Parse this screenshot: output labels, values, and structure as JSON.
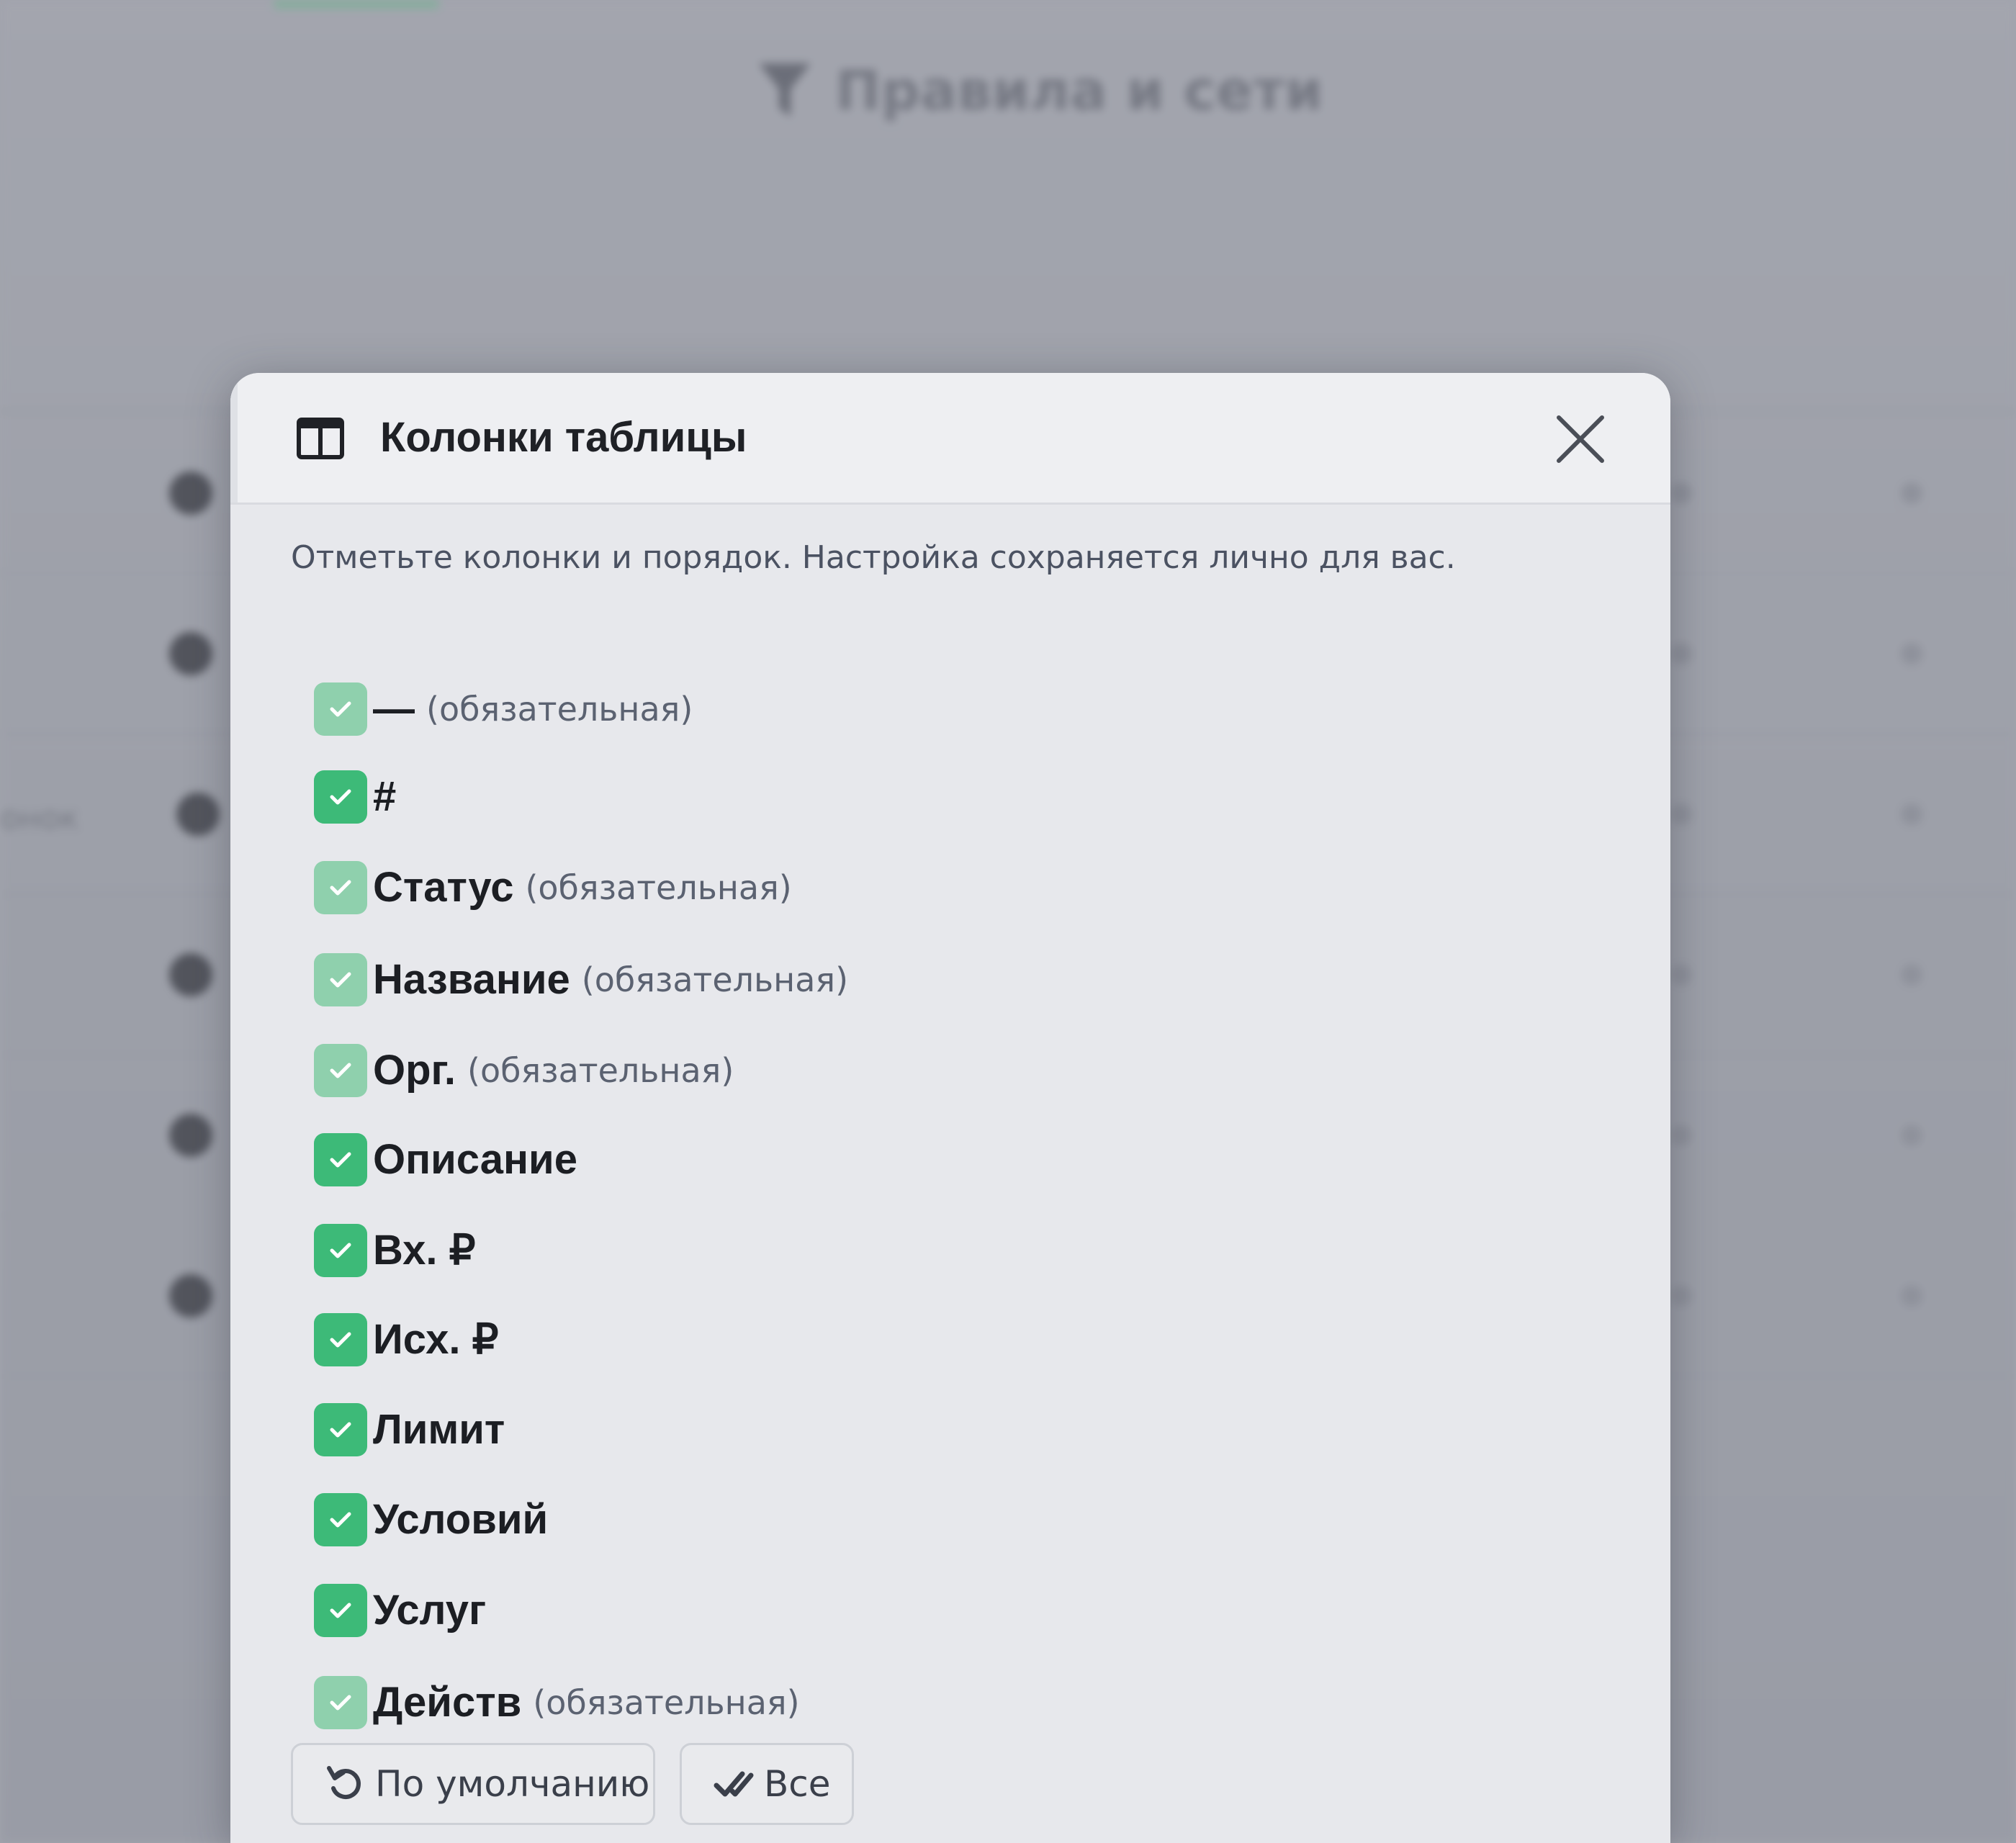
{
  "background": {
    "page_title": "Правила и сети",
    "left_fragment": "онок"
  },
  "dialog": {
    "title": "Колонки таблицы",
    "hint": "Отметьте колонки и порядок. Настройка сохраняется лично для вас.",
    "required_note": "(обязательная)",
    "columns": [
      {
        "label": "—",
        "required": true,
        "checked": true
      },
      {
        "label": "#",
        "required": false,
        "checked": true
      },
      {
        "label": "Статус",
        "required": true,
        "checked": true
      },
      {
        "label": "Название",
        "required": true,
        "checked": true
      },
      {
        "label": "Орг.",
        "required": true,
        "checked": true
      },
      {
        "label": "Описание",
        "required": false,
        "checked": true
      },
      {
        "label": "Вх. ₽",
        "required": false,
        "checked": true
      },
      {
        "label": "Исх. ₽",
        "required": false,
        "checked": true
      },
      {
        "label": "Лимит",
        "required": false,
        "checked": true
      },
      {
        "label": "Условий",
        "required": false,
        "checked": true
      },
      {
        "label": "Услуг",
        "required": false,
        "checked": true
      },
      {
        "label": "Действ",
        "required": true,
        "checked": true
      }
    ],
    "buttons": {
      "default_label": "По умолчанию",
      "all_label": "Все"
    }
  },
  "icons": {
    "header": "table-columns-icon",
    "close": "close-icon",
    "reset": "undo-icon",
    "select_all": "double-check-icon"
  },
  "colors": {
    "checkbox_active": "#3dba78",
    "checkbox_disabled": "#8fd0ad",
    "modal_bg": "#e7e8ec"
  }
}
